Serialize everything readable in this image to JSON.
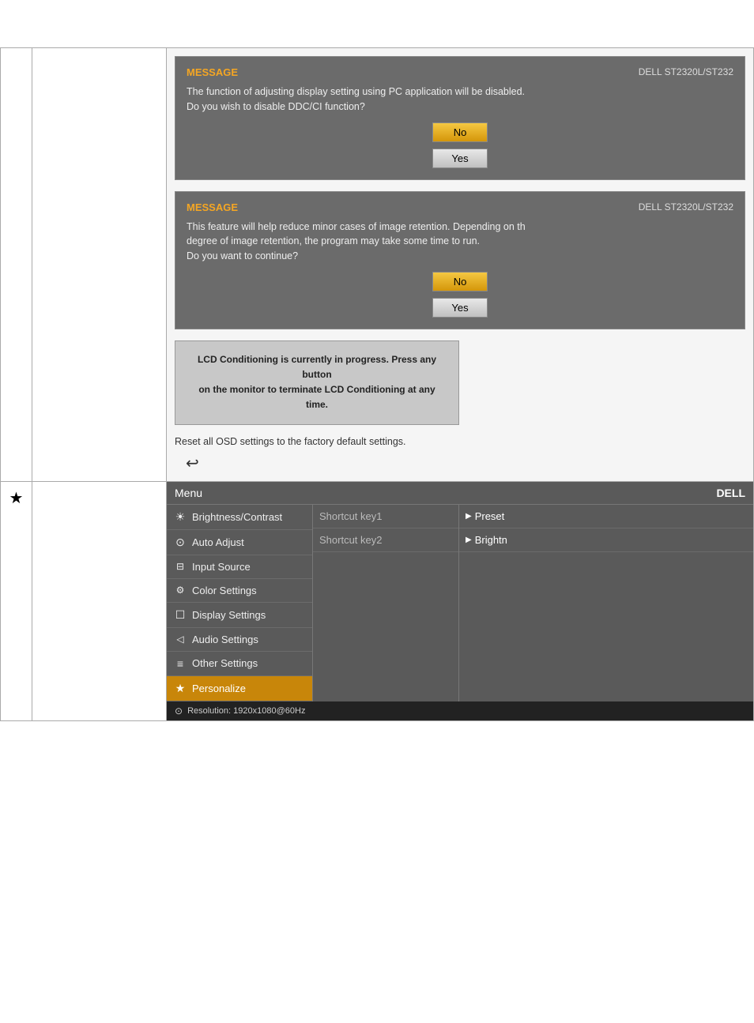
{
  "dialog1": {
    "model": "DELL  ST2320L/ST232",
    "message_label": "MESSAGE",
    "text_line1": "The function of adjusting display setting using PC application will be disabled.",
    "text_line2": "Do you wish to disable DDC/CI function?",
    "btn_no": "No",
    "btn_yes": "Yes"
  },
  "dialog2": {
    "model": "DELL  ST2320L/ST232",
    "message_label": "MESSAGE",
    "text_line1": "This feature will help reduce minor cases of image retention. Depending on th",
    "text_line2": "degree of image retention, the program may take some time to run.",
    "text_line3": "Do you want to continue?",
    "btn_no": "No",
    "btn_yes": "Yes"
  },
  "lcd_notice": {
    "line1": "LCD Conditioning is currently in progress. Press any button",
    "line2": "on the monitor to terminate LCD Conditioning at any time."
  },
  "reset_text": "Reset all OSD settings to the factory default settings.",
  "star_top": "★",
  "star_bottom": "★",
  "osd": {
    "title": "Menu",
    "brand": "DELL",
    "items": [
      {
        "icon": "☀",
        "label": "Brightness/Contrast"
      },
      {
        "icon": "⊙",
        "label": "Auto Adjust"
      },
      {
        "icon": "⊟",
        "label": "Input Source"
      },
      {
        "icon": "⚙",
        "label": "Color Settings"
      },
      {
        "icon": "☐",
        "label": "Display Settings"
      },
      {
        "icon": "🔈",
        "label": "Audio Settings"
      },
      {
        "icon": "≡",
        "label": "Other Settings"
      },
      {
        "icon": "★",
        "label": "Personalize",
        "active": true
      }
    ],
    "shortcuts": [
      {
        "label": "Shortcut key1",
        "value": "Preset"
      },
      {
        "label": "Shortcut key2",
        "value": "Brightn"
      }
    ],
    "footer_icon": "⊙",
    "footer_text": "Resolution:  1920x1080@60Hz"
  }
}
